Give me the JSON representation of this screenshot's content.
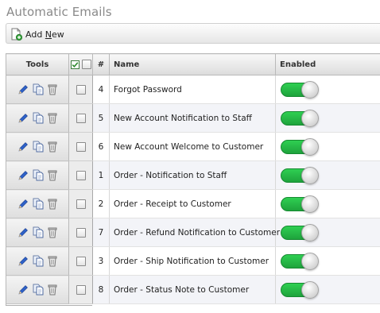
{
  "page": {
    "title": "Automatic Emails"
  },
  "toolbar": {
    "add_new_prefix": "Add ",
    "add_new_underlined": "N",
    "add_new_suffix": "ew"
  },
  "table": {
    "headers": {
      "tools": "Tools",
      "number": "#",
      "name": "Name",
      "enabled": "Enabled"
    },
    "rows": [
      {
        "number": "4",
        "name": "Forgot Password",
        "enabled": true
      },
      {
        "number": "5",
        "name": "New Account Notification to Staff",
        "enabled": true
      },
      {
        "number": "6",
        "name": "New Account Welcome to Customer",
        "enabled": true
      },
      {
        "number": "1",
        "name": "Order - Notification to Staff",
        "enabled": true
      },
      {
        "number": "2",
        "name": "Order - Receipt to Customer",
        "enabled": true
      },
      {
        "number": "7",
        "name": "Order - Refund Notification to Customer",
        "enabled": true
      },
      {
        "number": "3",
        "name": "Order - Ship Notification to Customer",
        "enabled": true
      },
      {
        "number": "8",
        "name": "Order - Status Note to Customer",
        "enabled": true
      }
    ]
  },
  "icons": {
    "add": "add-document-icon",
    "edit": "pencil-icon",
    "copy": "copy-document-icon",
    "delete": "trash-icon"
  },
  "colors": {
    "toggle_on": "#22b845",
    "title": "#8a8a8a",
    "row_alt": "#f3f4f8"
  }
}
